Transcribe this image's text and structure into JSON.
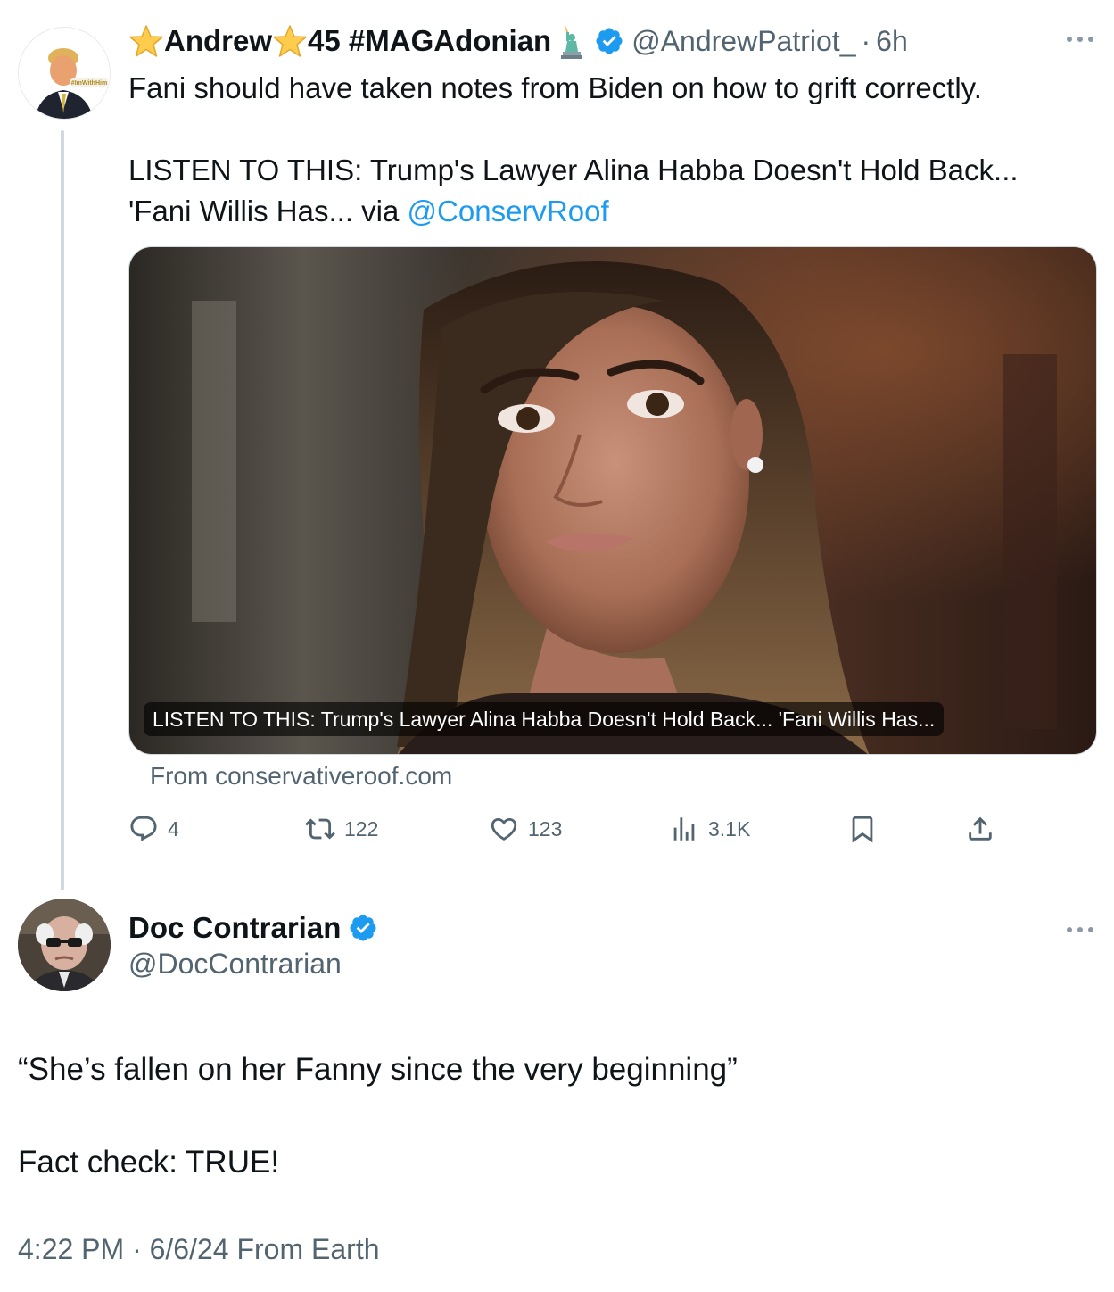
{
  "parent_tweet": {
    "display_name_part1": "Andrew",
    "display_name_part2": "45 #MAGAdonian",
    "handle": "@AndrewPatriot_",
    "separator": "·",
    "time": "6h",
    "avatar_badge_text": "#ImWithHim",
    "text_line1": "Fani should have taken notes from Biden on how to grift correctly.",
    "text_line2": "LISTEN TO THIS: Trump's Lawyer Alina Habba Doesn't Hold Back...",
    "text_line3_prefix": "'Fani Willis Has... via ",
    "text_mention": "@ConservRoof",
    "card": {
      "caption": "LISTEN TO THIS: Trump's Lawyer Alina Habba Doesn't Hold Back... 'Fani Willis Has...",
      "source": "From conservativeroof.com"
    },
    "actions": {
      "replies": "4",
      "retweets": "122",
      "likes": "123",
      "views": "3.1K"
    }
  },
  "main_tweet": {
    "display_name": "Doc Contrarian",
    "handle": "@DocContrarian",
    "text_line1": "“She’s fallen on her Fanny since the very beginning”",
    "text_line2": "Fact check:  TRUE!",
    "meta": "4:22 PM · 6/6/24 From Earth"
  },
  "colors": {
    "link": "#1d9bf0",
    "secondary_text": "#536471",
    "verified_badge": "#1d9bf0",
    "thread_line": "#cfd9de"
  },
  "icons": [
    "star-icon",
    "statue-of-liberty-icon",
    "verified-badge-icon",
    "more-icon",
    "reply-icon",
    "retweet-icon",
    "like-icon",
    "views-icon",
    "bookmark-icon",
    "share-icon"
  ]
}
